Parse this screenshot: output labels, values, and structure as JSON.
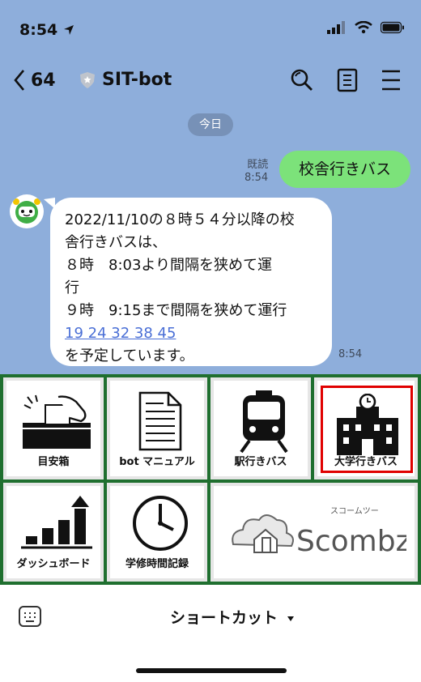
{
  "status_bar": {
    "time": "8:54"
  },
  "header": {
    "back_count": "64",
    "title": "SIT-bot"
  },
  "chat": {
    "date_label": "今日",
    "outgoing": {
      "read_label": "既読",
      "time": "8:54",
      "text": "校舎行きバス"
    },
    "incoming": {
      "lines": [
        "2022/11/10の８時５４分以降の校",
        "舎行きバスは、",
        "８時　8:03より間隔を狭めて運",
        "行",
        "９時　9:15まで間隔を狭めて運行"
      ],
      "link_text": "19 24 32 38 45",
      "last_line": "を予定しています。",
      "time": "8:54"
    }
  },
  "menu": {
    "items": [
      {
        "label": "目安箱",
        "icon": "ballot-box-icon"
      },
      {
        "label": "bot マニュアル",
        "icon": "document-icon"
      },
      {
        "label": "駅行きバス",
        "icon": "train-icon"
      },
      {
        "label": "大学行きバス",
        "icon": "building-icon"
      },
      {
        "label": "ダッシュボード",
        "icon": "bar-chart-icon"
      },
      {
        "label": "学修時間記録",
        "icon": "clock-icon"
      },
      {
        "label": "Scombz",
        "icon": "scombz-logo",
        "subtitle": "スコームツー"
      }
    ]
  },
  "bottom": {
    "shortcut_label": "ショートカット"
  },
  "colors": {
    "chat_background": "#8EAEDB",
    "outgoing_bubble": "#7CE27A",
    "menu_border": "#1F6F2F",
    "highlight": "#E00000"
  }
}
